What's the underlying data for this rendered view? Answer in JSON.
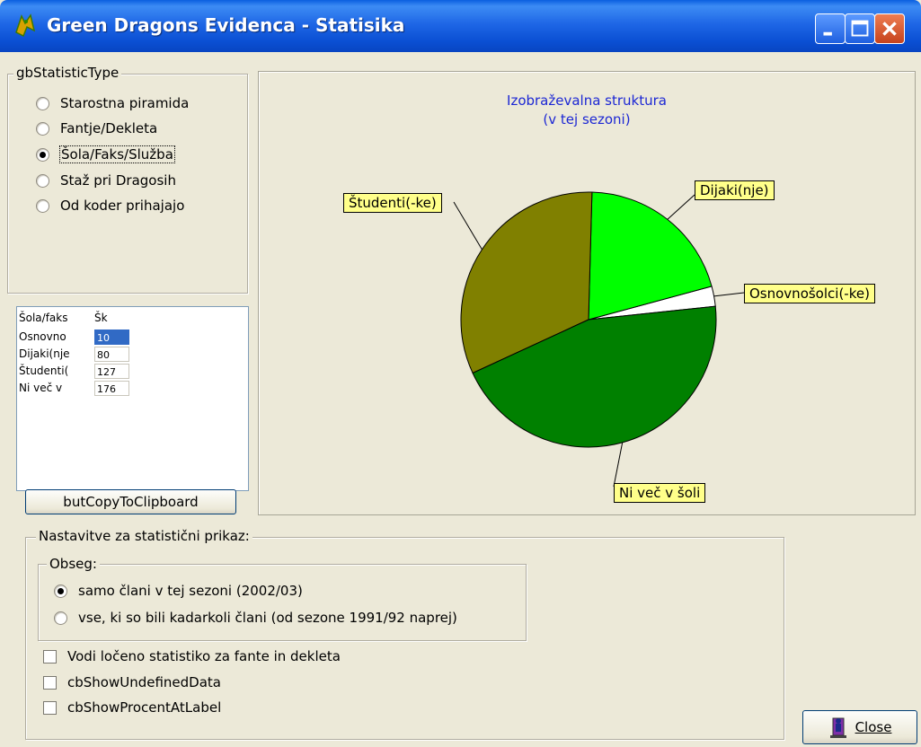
{
  "window": {
    "title": "Green Dragons Evidenca - Statisika"
  },
  "statistic_type": {
    "caption": "gbStatisticType",
    "options": [
      {
        "label": "Starostna piramida",
        "selected": false
      },
      {
        "label": "Fantje/Dekleta",
        "selected": false
      },
      {
        "label": "Šola/Faks/Služba",
        "selected": true
      },
      {
        "label": "Staž pri Dragosih",
        "selected": false
      },
      {
        "label": "Od koder prihajajo",
        "selected": false
      }
    ]
  },
  "grid": {
    "header": [
      "Šola/faks",
      "Šk"
    ],
    "rows": [
      {
        "label": "Osnovno",
        "value": "10"
      },
      {
        "label": "Dijaki(nje",
        "value": "80"
      },
      {
        "label": "Študenti(",
        "value": "127"
      },
      {
        "label": "Ni več v",
        "value": "176"
      }
    ]
  },
  "copy_button": {
    "label": "butCopyToClipboard"
  },
  "chart_data": {
    "type": "pie",
    "title": "Izobraževalna struktura",
    "subtitle": "(v tej sezoni)",
    "slices": [
      {
        "label": "Osnovnošolci(-ke)",
        "value": 10,
        "color": "#ffffff"
      },
      {
        "label": "Dijaki(nje)",
        "value": 80,
        "color": "#00ff00"
      },
      {
        "label": "Študenti(-ke)",
        "value": 127,
        "color": "#808000"
      },
      {
        "label": "Ni več v šoli",
        "value": 176,
        "color": "#008000"
      }
    ]
  },
  "settings": {
    "caption": "Nastavitve za statistični prikaz:",
    "scope": {
      "caption": "Obseg:",
      "options": [
        {
          "label": "samo člani v tej sezoni (2002/03)",
          "selected": true
        },
        {
          "label": "vse, ki so bili kadarkoli člani (od sezone 1991/92 naprej)",
          "selected": false
        }
      ]
    },
    "checkboxes": [
      {
        "label": "Vodi ločeno statistiko za fante in dekleta",
        "checked": false
      },
      {
        "label": "cbShowUndefinedData",
        "checked": false
      },
      {
        "label": "cbShowProcentAtLabel",
        "checked": false
      }
    ]
  },
  "close_button": {
    "label": "Close"
  }
}
